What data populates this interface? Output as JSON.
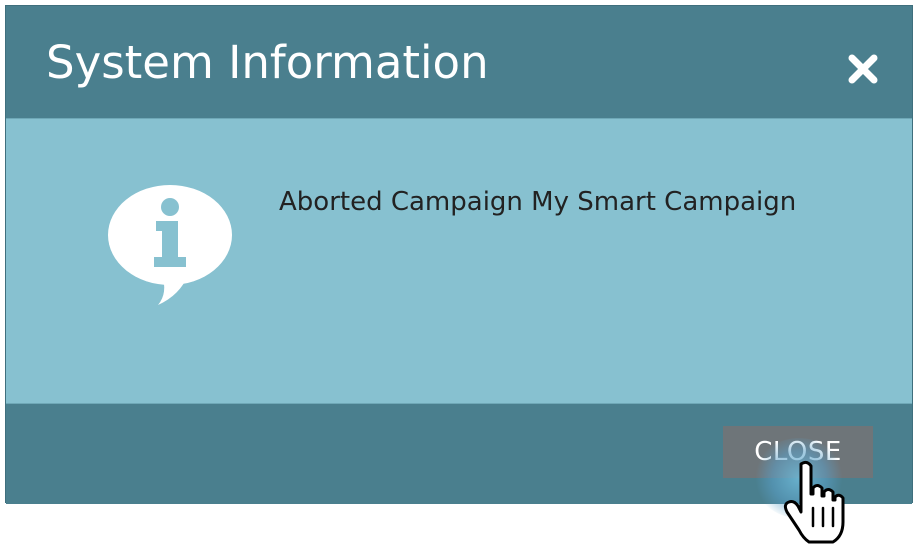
{
  "dialog": {
    "title": "System Information",
    "close_icon": "close-x-icon",
    "message": "Aborted Campaign My Smart Campaign",
    "info_icon": "info-speech-bubble-icon",
    "close_button_label": "CLOSE"
  },
  "colors": {
    "header_bg": "#4a7f8e",
    "body_bg": "#87c1d0",
    "button_bg": "#6e7579",
    "text_light": "#ffffff",
    "text_dark": "#222222"
  },
  "cursor": {
    "icon": "pointer-hand-icon"
  }
}
